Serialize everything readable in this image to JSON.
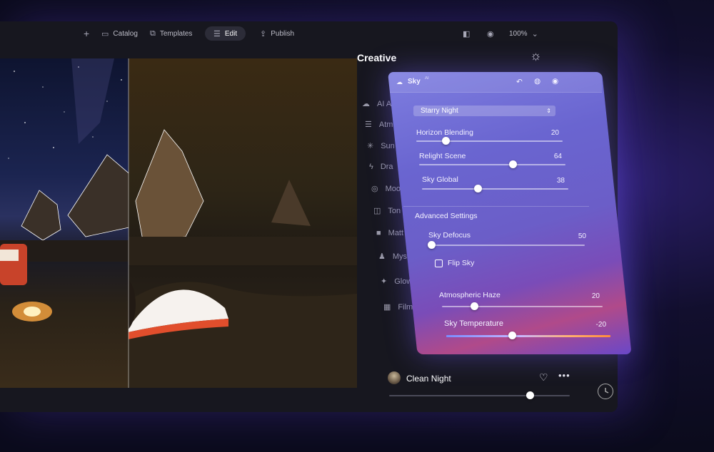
{
  "toolbar": {
    "add_icon": "plus-icon",
    "catalog": "Catalog",
    "templates": "Templates",
    "edit": "Edit",
    "publish": "Publish",
    "zoom": "100%"
  },
  "creative": {
    "title": "Creative",
    "tools": [
      "AI A",
      "Atm",
      "Sun",
      "Dra",
      "Moo",
      "Ton",
      "Matt",
      "Myst",
      "Glow",
      "Film"
    ]
  },
  "sky_panel": {
    "title": "Sky",
    "version": "AI",
    "preset": "Starry Night",
    "sliders": [
      {
        "label": "Horizon Blending",
        "value": 20
      },
      {
        "label": "Relight Scene",
        "value": 64
      },
      {
        "label": "Sky Global",
        "value": 38
      }
    ],
    "advanced_title": "Advanced Settings",
    "defocus": {
      "label": "Sky Defocus",
      "value": 50
    },
    "flip_sky": "Flip Sky",
    "haze": {
      "label": "Atmospheric Haze",
      "value": 20
    },
    "temperature": {
      "label": "Sky Temperature",
      "value": -20
    }
  },
  "preset_bar": {
    "name": "Clean Night",
    "amount": 0.78
  },
  "colors": {
    "accent": "#6a65d0",
    "background": "#17171f"
  }
}
